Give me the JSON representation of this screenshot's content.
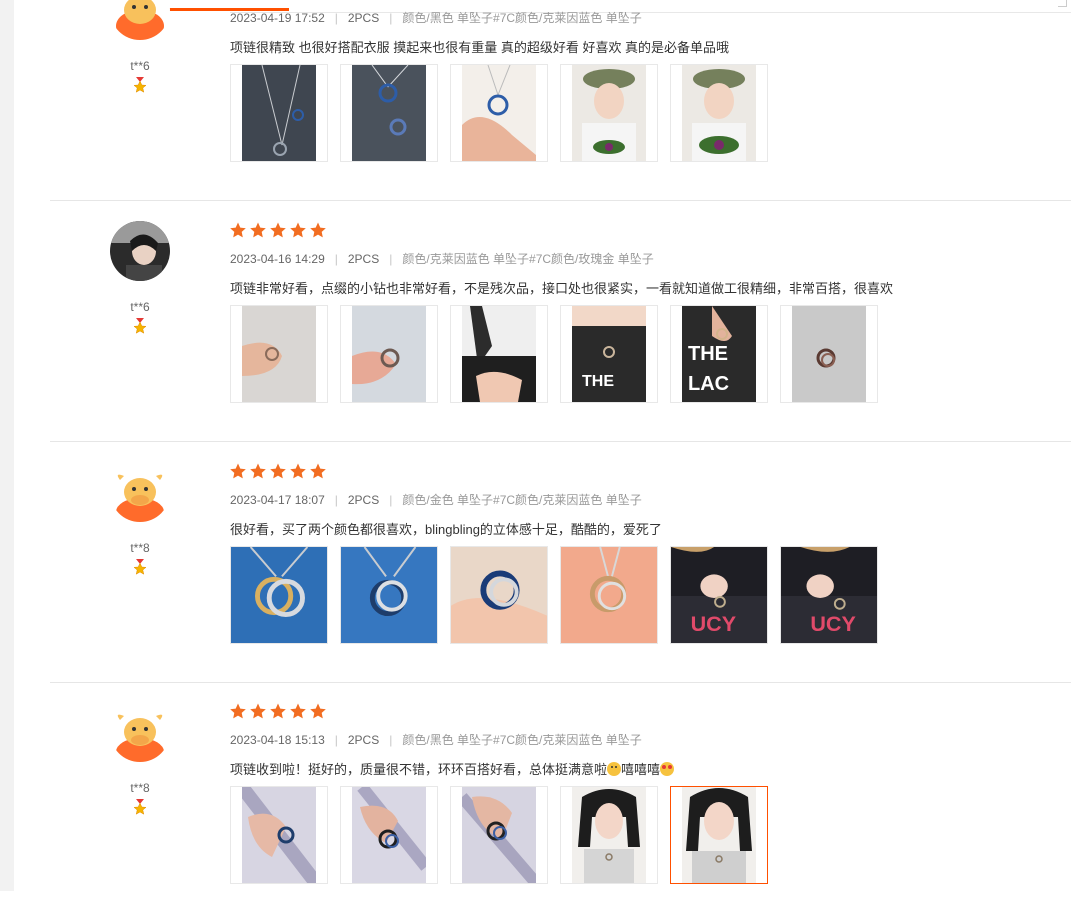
{
  "reviews": [
    {
      "user": "t**6",
      "avatar": "cow-avatar",
      "date": "2023-04-19 17:52",
      "pcs": "2PCS",
      "sku": "颜色/黑色 单坠子#7C颜色/克莱因蓝色 单坠子",
      "content": "项链很精致 也很好搭配衣服 摸起来也很有重量 真的超级好看 好喜欢 真的是必备单品哦",
      "images": [
        "product-photo",
        "product-photo",
        "product-photo",
        "wearing-photo",
        "wearing-photo"
      ]
    },
    {
      "user": "t**6",
      "avatar": "photo-avatar",
      "date": "2023-04-16 14:29",
      "pcs": "2PCS",
      "sku": "颜色/克莱因蓝色 单坠子#7C颜色/玫瑰金 单坠子",
      "content": "项链非常好看，点缀的小钻也非常好看，不是残次品，接口处也很紧实，一看就知道做工很精细，非常百搭，很喜欢",
      "images": [
        "hand-photo",
        "hand-photo",
        "wearing-photo",
        "wearing-photo",
        "wearing-photo",
        "product-photo"
      ]
    },
    {
      "user": "t**8",
      "avatar": "cow-avatar",
      "date": "2023-04-17 18:07",
      "pcs": "2PCS",
      "sku": "颜色/金色 单坠子#7C颜色/克莱因蓝色 单坠子",
      "content": "很好看，买了两个颜色都很喜欢，blingbling的立体感十足，酷酷的，爱死了",
      "images": [
        "product-photo",
        "product-photo",
        "product-photo",
        "hand-photo",
        "wearing-photo",
        "wearing-photo"
      ]
    },
    {
      "user": "t**8",
      "avatar": "cow-avatar",
      "date": "2023-04-18 15:13",
      "pcs": "2PCS",
      "sku": "颜色/黑色 单坠子#7C颜色/克莱因蓝色 单坠子",
      "content": "项链收到啦！挺好的，质量很不错，环环百搭好看，总体挺满意啦",
      "content_tail": "嘻嘻嘻",
      "images": [
        "hand-photo",
        "hand-photo",
        "hand-photo",
        "wearing-photo",
        "wearing-photo"
      ],
      "selected_image": 4
    }
  ],
  "colors": {
    "star": "#f26d21",
    "accent": "#ff5000",
    "cow_bg": "#ff8a3d"
  }
}
